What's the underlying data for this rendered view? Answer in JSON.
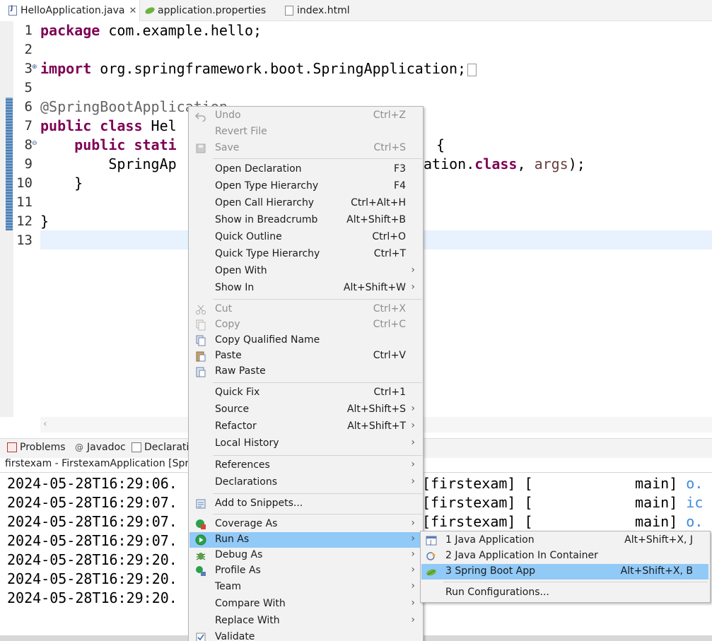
{
  "editor_tabs": [
    {
      "label": "HelloApplication.java",
      "icon": "java-file-icon",
      "active": true
    },
    {
      "label": "application.properties",
      "icon": "spring-leaf-icon",
      "active": false
    },
    {
      "label": "index.html",
      "icon": "html-file-icon",
      "active": false
    }
  ],
  "code": {
    "line_numbers": [
      "1",
      "2",
      "3",
      "5",
      "6",
      "7",
      "8",
      "9",
      "10",
      "11",
      "12",
      "13"
    ],
    "l1_kw": "package",
    "l1_rest": " com.example.hello;",
    "l3_kw": "import",
    "l3_rest": " org.springframework.boot.SpringApplication;",
    "l6": "@SpringBootApplication",
    "l7_kw1": "public",
    "l7_kw2": "class",
    "l7_rest": " Hel",
    "l8_kw1": "public",
    "l8_kw2": "stati",
    "l8_tail": " {",
    "l9_a": "SpringAp",
    "l9_b": "ation.",
    "l9_kw": "class",
    "l9_c": ", ",
    "l9_var": "args",
    "l9_d": ");",
    "l10": "}",
    "l12": "}"
  },
  "panel_tabs": [
    {
      "label": "Problems",
      "icon": "problems-icon"
    },
    {
      "label": "Javadoc",
      "icon": "javadoc-icon"
    },
    {
      "label": "Declarati",
      "icon": "declaration-icon"
    }
  ],
  "console": {
    "title": "firstexam - FirstexamApplication [Sprir",
    "timestamps": [
      "2024-05-28T16:29:06.",
      "2024-05-28T16:29:07.",
      "2024-05-28T16:29:07.",
      "2024-05-28T16:29:07.",
      "2024-05-28T16:29:20.",
      "2024-05-28T16:29:20.",
      "2024-05-28T16:29:20."
    ],
    "right_lines": [
      {
        "text": "[firstexam] [            main] ",
        "tail": "o."
      },
      {
        "text": "[firstexam] [            main] ",
        "tail": "ic"
      },
      {
        "text": "[firstexam] [            main] ",
        "tail": "o."
      }
    ]
  },
  "context_menu": {
    "items": [
      {
        "label": "Undo",
        "shortcut": "Ctrl+Z",
        "icon": "undo-icon",
        "disabled": true
      },
      {
        "label": "Revert File",
        "shortcut": "",
        "icon": "",
        "disabled": true
      },
      {
        "label": "Save",
        "shortcut": "Ctrl+S",
        "icon": "save-icon",
        "disabled": true
      },
      {
        "label": "Open Declaration",
        "shortcut": "F3"
      },
      {
        "label": "Open Type Hierarchy",
        "shortcut": "F4"
      },
      {
        "label": "Open Call Hierarchy",
        "shortcut": "Ctrl+Alt+H"
      },
      {
        "label": "Show in Breadcrumb",
        "shortcut": "Alt+Shift+B"
      },
      {
        "label": "Quick Outline",
        "shortcut": "Ctrl+O"
      },
      {
        "label": "Quick Type Hierarchy",
        "shortcut": "Ctrl+T"
      },
      {
        "label": "Open With",
        "shortcut": "",
        "submenu": true
      },
      {
        "label": "Show In",
        "shortcut": "Alt+Shift+W",
        "submenu": true
      },
      {
        "label": "Cut",
        "shortcut": "Ctrl+X",
        "icon": "cut-icon",
        "disabled": true
      },
      {
        "label": "Copy",
        "shortcut": "Ctrl+C",
        "icon": "copy-icon",
        "disabled": true
      },
      {
        "label": "Copy Qualified Name",
        "shortcut": "",
        "icon": "copy-qualified-icon"
      },
      {
        "label": "Paste",
        "shortcut": "Ctrl+V",
        "icon": "paste-icon"
      },
      {
        "label": "Raw Paste",
        "shortcut": "",
        "icon": "raw-paste-icon"
      },
      {
        "label": "Quick Fix",
        "shortcut": "Ctrl+1"
      },
      {
        "label": "Source",
        "shortcut": "Alt+Shift+S",
        "submenu": true
      },
      {
        "label": "Refactor",
        "shortcut": "Alt+Shift+T",
        "submenu": true
      },
      {
        "label": "Local History",
        "shortcut": "",
        "submenu": true
      },
      {
        "label": "References",
        "shortcut": "",
        "submenu": true
      },
      {
        "label": "Declarations",
        "shortcut": "",
        "submenu": true
      },
      {
        "label": "Add to Snippets...",
        "shortcut": "",
        "icon": "snippets-icon"
      },
      {
        "label": "Coverage As",
        "shortcut": "",
        "icon": "coverage-icon",
        "submenu": true
      },
      {
        "label": "Run As",
        "shortcut": "",
        "icon": "run-icon",
        "submenu": true,
        "highlight": true
      },
      {
        "label": "Debug As",
        "shortcut": "",
        "icon": "debug-icon",
        "submenu": true
      },
      {
        "label": "Profile As",
        "shortcut": "",
        "icon": "profile-icon",
        "submenu": true
      },
      {
        "label": "Team",
        "shortcut": "",
        "submenu": true
      },
      {
        "label": "Compare With",
        "shortcut": "",
        "submenu": true
      },
      {
        "label": "Replace With",
        "shortcut": "",
        "submenu": true
      },
      {
        "label": "Validate",
        "shortcut": "",
        "icon": "validate-icon"
      }
    ]
  },
  "run_as_submenu": {
    "items": [
      {
        "label": "1 Java Application",
        "shortcut": "Alt+Shift+X, J",
        "icon": "java-app-icon"
      },
      {
        "label": "2 Java Application In Container",
        "shortcut": "",
        "icon": "container-app-icon"
      },
      {
        "label": "3 Spring Boot App",
        "shortcut": "Alt+Shift+X, B",
        "icon": "spring-boot-icon",
        "highlight": true
      },
      {
        "label": "Run Configurations...",
        "shortcut": ""
      }
    ]
  },
  "colors": {
    "keyword": "#7f0055",
    "annotation": "#646464",
    "menu_highlight": "#91c9f7",
    "console_link": "#3d8bdb"
  }
}
